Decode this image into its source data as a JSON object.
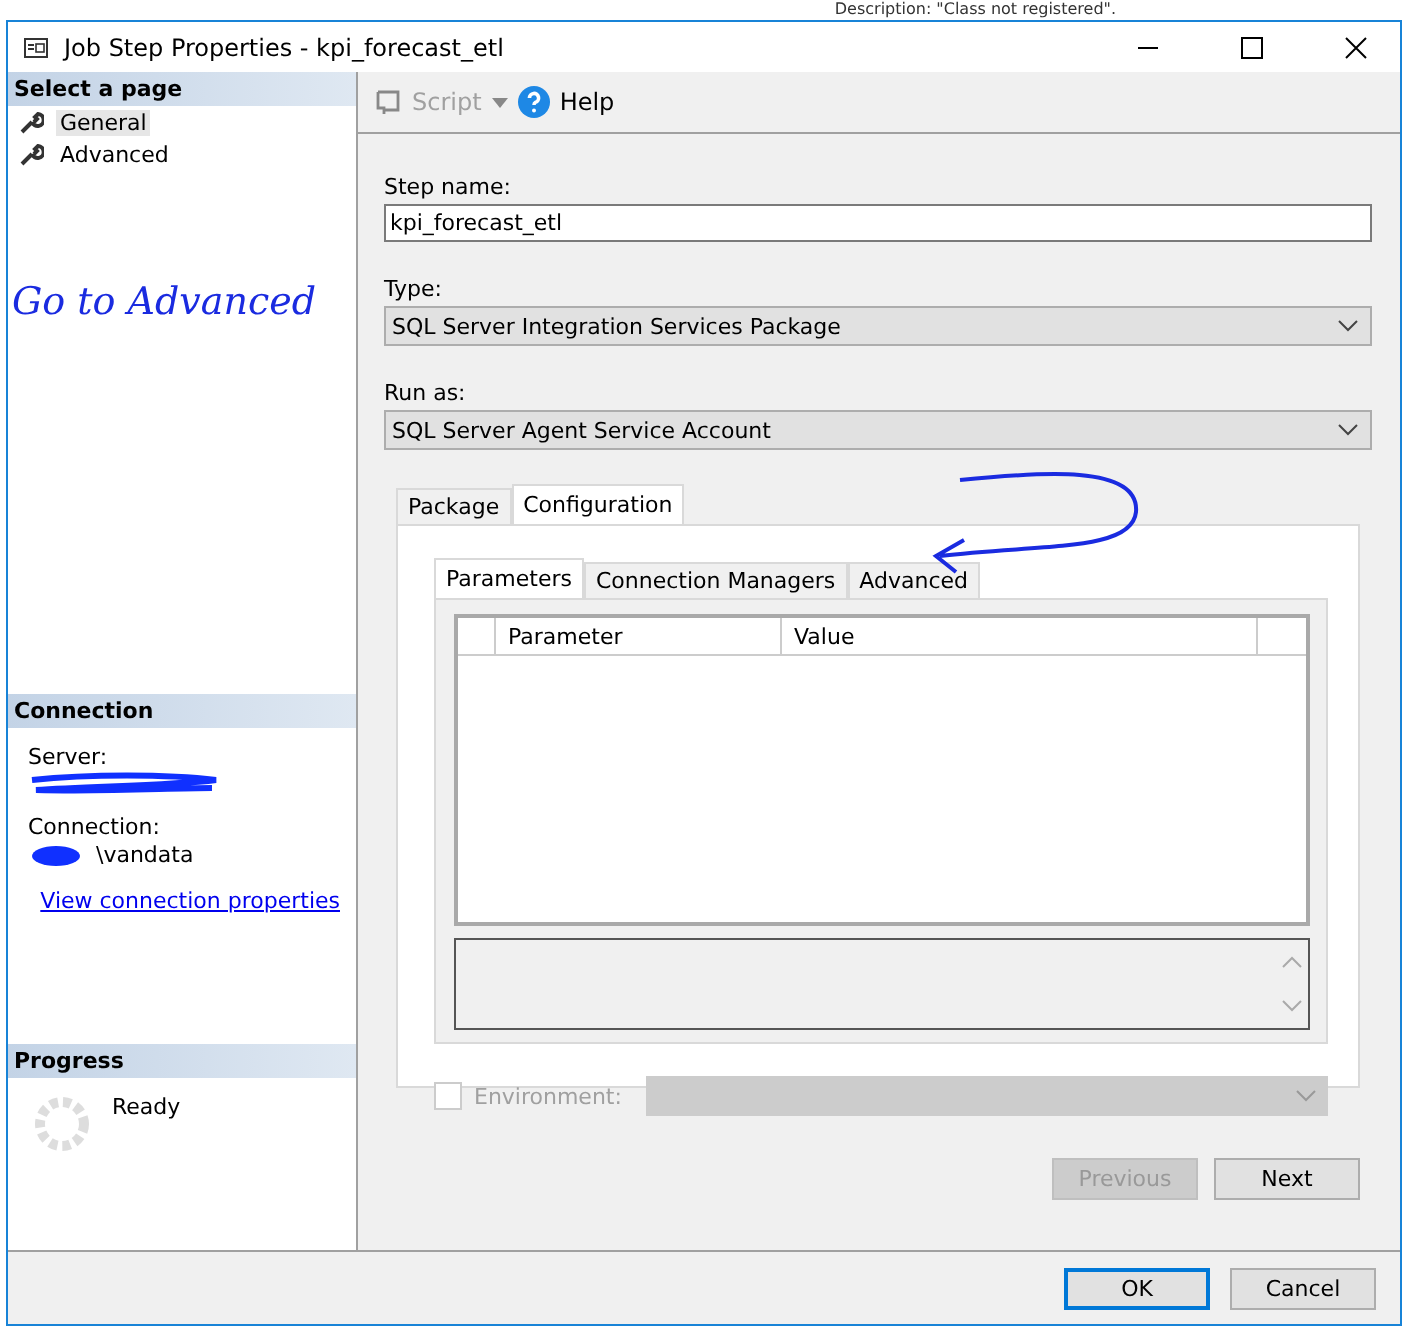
{
  "background": {
    "text": "Description:  \"Class not registered\"."
  },
  "window": {
    "title": "Job Step Properties - kpi_forecast_etl"
  },
  "sidebar": {
    "header": "Select a page",
    "items": [
      {
        "label": "General",
        "selected": true
      },
      {
        "label": "Advanced",
        "selected": false
      }
    ]
  },
  "connection": {
    "header": "Connection",
    "server_label": "Server:",
    "connection_label": "Connection:",
    "connection_value": "\\vandata",
    "link": "View connection properties"
  },
  "progress": {
    "header": "Progress",
    "status": "Ready"
  },
  "toolbar": {
    "script": {
      "label": "Script",
      "disabled": true
    },
    "help": "Help"
  },
  "form": {
    "step_name": {
      "label": "Step name:",
      "value": "kpi_forecast_etl"
    },
    "type": {
      "label": "Type:",
      "value": "SQL Server Integration Services Package"
    },
    "run_as": {
      "label": "Run as:",
      "value": "SQL Server Agent Service Account"
    }
  },
  "tabs": [
    {
      "label": "Package",
      "selected": false
    },
    {
      "label": "Configuration",
      "selected": true
    }
  ],
  "subtabs": [
    {
      "label": "Parameters",
      "selected": true
    },
    {
      "label": "Connection Managers",
      "selected": false
    },
    {
      "label": "Advanced",
      "selected": false
    }
  ],
  "table": {
    "columns": [
      "Parameter",
      "Value"
    ]
  },
  "environment": {
    "label": "Environment:",
    "checked": false,
    "disabled": true
  },
  "nav_buttons": [
    {
      "label": "Previous",
      "disabled": true
    },
    {
      "label": "Next",
      "disabled": false
    }
  ],
  "buttons": [
    {
      "label": "OK",
      "default": true
    },
    {
      "label": "Cancel",
      "default": false
    }
  ],
  "annotation": {
    "text": "Go to Advanced"
  }
}
